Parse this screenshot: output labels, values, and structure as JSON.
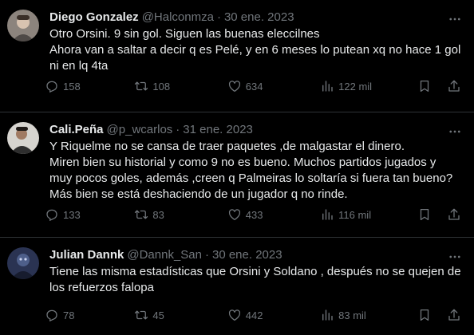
{
  "tweets": [
    {
      "name": "Diego Gonzalez",
      "handle": "@Halconmza",
      "date": "30 ene. 2023",
      "text": "Otro Orsini. 9 sin gol. Siguen las buenas eleccilnes\nAhora van a saltar a decir q es Pelé, y en 6 meses lo putean xq no hace 1 gol ni en lq 4ta",
      "replies": "158",
      "retweets": "108",
      "likes": "634",
      "views": "122 mil",
      "avatar_colors": [
        "#9a8f86",
        "#5b534e"
      ]
    },
    {
      "name": "Cali.Peña",
      "handle": "@p_wcarlos",
      "date": "31 ene. 2023",
      "text": "Y Riquelme no se cansa de traer paquetes ,de malgastar el dinero.\nMiren bien su historial y como 9 no es bueno. Muchos partidos jugados y muy pocos goles, además ,creen q Palmeiras lo soltaría si fuera tan bueno?\nMás bien se está deshaciendo de un jugador q no rinde.",
      "replies": "133",
      "retweets": "83",
      "likes": "433",
      "views": "116 mil",
      "avatar_colors": [
        "#c9c7c2",
        "#3b3b3b"
      ]
    },
    {
      "name": "Julian Dannk",
      "handle": "@Dannk_San",
      "date": "30 ene. 2023",
      "text": "Tiene las misma estadísticas que Orsini y Soldano , después no se quejen de los refuerzos falopa",
      "replies": "78",
      "retweets": "45",
      "likes": "442",
      "views": "83 mil",
      "avatar_colors": [
        "#3b4a6b",
        "#1a2033"
      ]
    }
  ],
  "icons": {
    "more": "more-horizontal-icon",
    "reply": "reply-icon",
    "retweet": "retweet-icon",
    "like": "heart-icon",
    "views": "views-chart-icon",
    "bookmark": "bookmark-icon",
    "share": "share-icon"
  },
  "colors": {
    "background": "#000000",
    "text": "#e7e9ea",
    "secondary": "#71767b",
    "divider": "#2f3336"
  }
}
